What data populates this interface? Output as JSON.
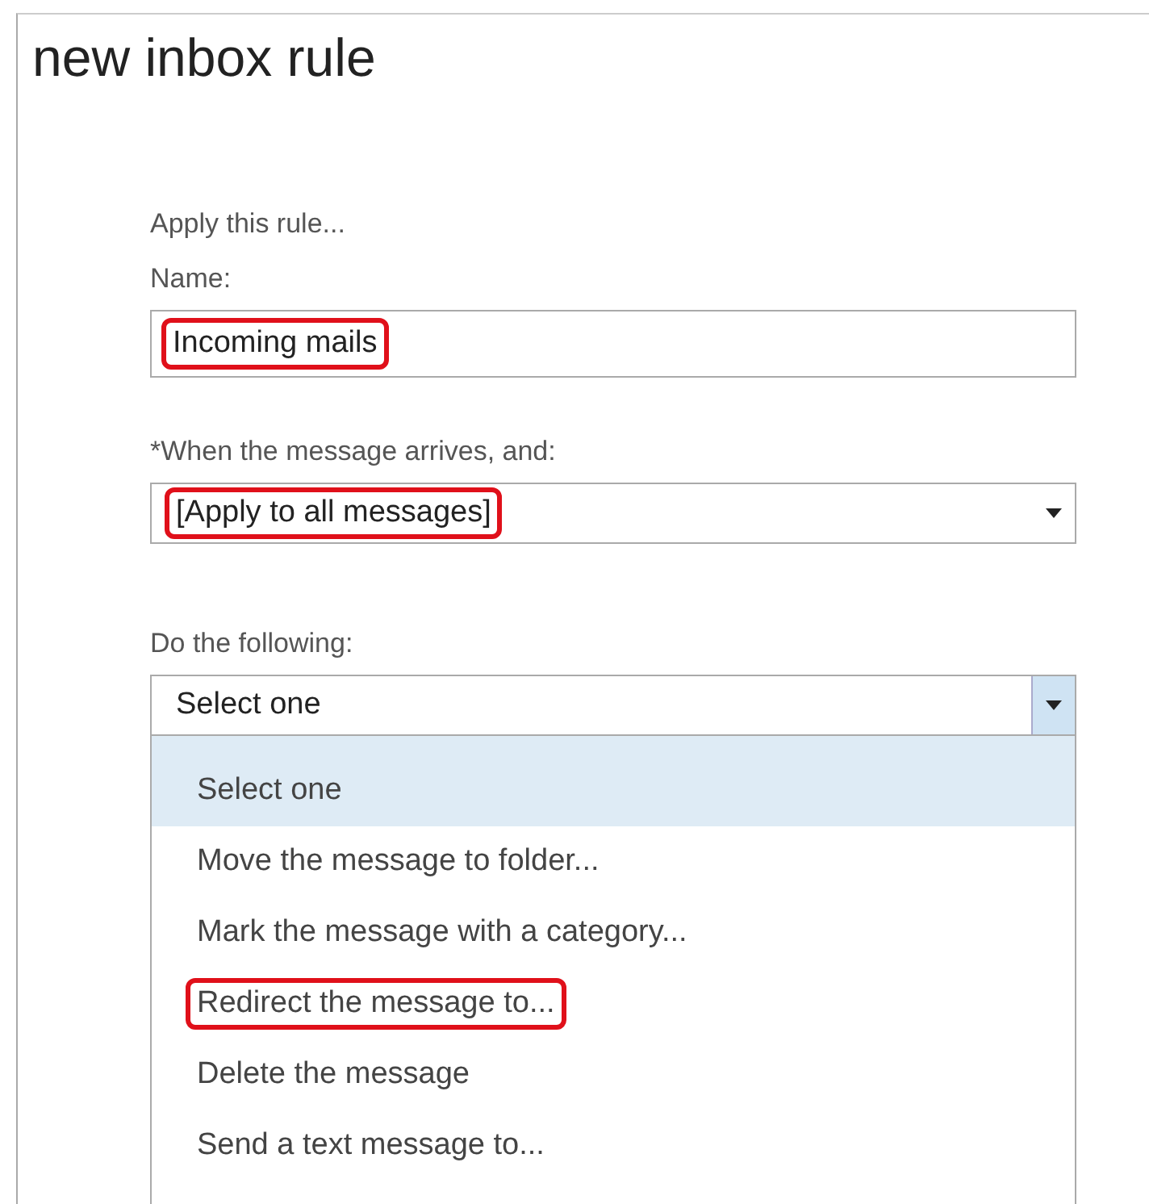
{
  "title": "new inbox rule",
  "intro": "Apply this rule...",
  "name_field": {
    "label": "Name:",
    "value": "Incoming mails",
    "highlighted": true
  },
  "condition": {
    "label": "*When the message arrives, and:",
    "value": "[Apply to all messages]",
    "highlighted": true,
    "expanded": false
  },
  "action": {
    "label": "Do the following:",
    "value": "Select one",
    "highlighted": false,
    "expanded": true,
    "options": [
      {
        "label": "Select one",
        "selected": true,
        "highlighted": false
      },
      {
        "label": "Move the message to folder...",
        "selected": false,
        "highlighted": false
      },
      {
        "label": "Mark the message with a category...",
        "selected": false,
        "highlighted": false
      },
      {
        "label": "Redirect the message to...",
        "selected": false,
        "highlighted": true
      },
      {
        "label": "Delete the message",
        "selected": false,
        "highlighted": false
      },
      {
        "label": "Send a text message to...",
        "selected": false,
        "highlighted": false
      }
    ]
  }
}
